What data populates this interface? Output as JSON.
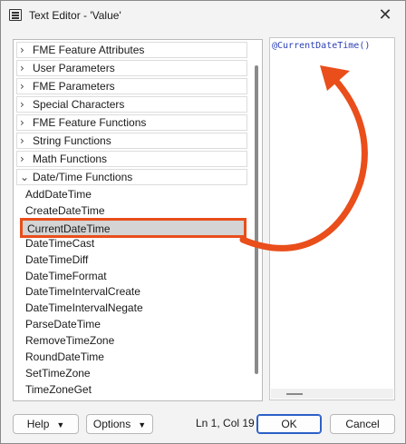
{
  "window": {
    "title": "Text Editor - 'Value'",
    "close_glyph": "✕"
  },
  "categories": [
    {
      "label": "FME Feature Attributes",
      "chevron": "›"
    },
    {
      "label": "User Parameters",
      "chevron": "›"
    },
    {
      "label": "FME Parameters",
      "chevron": "›"
    },
    {
      "label": "Special Characters",
      "chevron": "›"
    },
    {
      "label": "FME Feature Functions",
      "chevron": "›"
    },
    {
      "label": "String Functions",
      "chevron": "›"
    },
    {
      "label": "Math Functions",
      "chevron": "›"
    },
    {
      "label": "Date/Time Functions",
      "chevron": "⌄"
    }
  ],
  "functions": [
    "AddDateTime",
    "CreateDateTime",
    "CurrentDateTime",
    "DateTimeCast",
    "DateTimeDiff",
    "DateTimeFormat",
    "DateTimeIntervalCreate",
    "DateTimeIntervalNegate",
    "ParseDateTime",
    "RemoveTimeZone",
    "RoundDateTime",
    "SetTimeZone",
    "TimeZoneGet"
  ],
  "selected_function_index": 2,
  "editor": {
    "text": "@CurrentDateTime()"
  },
  "footer": {
    "help_label": "Help",
    "options_label": "Options",
    "caret": "▼",
    "status": "Ln 1, Col 19",
    "ok_label": "OK",
    "cancel_label": "Cancel"
  },
  "colors": {
    "highlight": "#e94e1b",
    "editor_text": "#2b3fb5"
  }
}
